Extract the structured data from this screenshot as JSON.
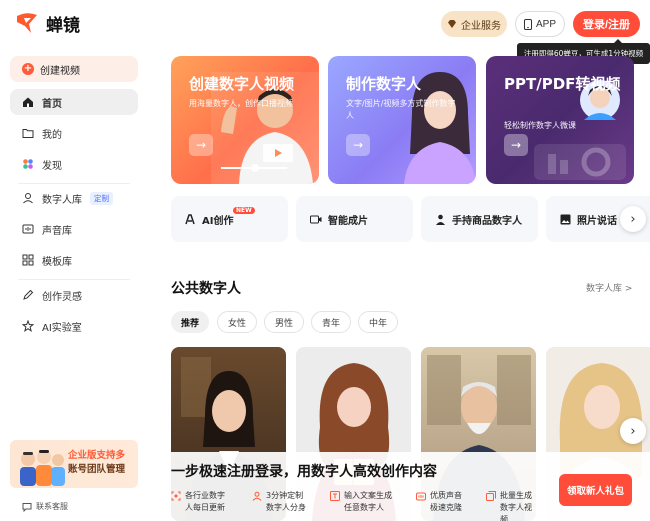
{
  "app": {
    "name": "蝉镜"
  },
  "header": {
    "enterprise_label": "企业服务",
    "app_label": "APP",
    "login_label": "登录/注册",
    "tooltip": "注册即得60蝉豆，可生成1分钟视频"
  },
  "sidebar": {
    "create_label": "创建视频",
    "items": [
      {
        "label": "首页",
        "icon": "home-icon",
        "active": true
      },
      {
        "label": "我的",
        "icon": "folder-icon"
      },
      {
        "label": "发现",
        "icon": "discover-icon"
      },
      {
        "label": "数字人库",
        "icon": "person-icon",
        "badge": "定制"
      },
      {
        "label": "声音库",
        "icon": "sound-icon"
      },
      {
        "label": "模板库",
        "icon": "template-icon"
      },
      {
        "label": "创作灵感",
        "icon": "pen-icon"
      },
      {
        "label": "AI实验室",
        "icon": "lab-icon"
      }
    ],
    "promo": {
      "line1": "企业版支持多",
      "line2": "账号团队管理"
    },
    "service_label": "联系客服"
  },
  "banners": [
    {
      "title": "创建数字人视频",
      "subtitle": "用海量数字人，创作口播视频"
    },
    {
      "title": "制作数字人",
      "subtitle": "文字/图片/视频多方式制作数字人"
    },
    {
      "title": "PPT/PDF转视频",
      "subtitle": "轻松制作数字人微课"
    }
  ],
  "features": [
    {
      "label": "AI创作",
      "new": "NEW"
    },
    {
      "label": "智能成片"
    },
    {
      "label": "手持商品数字人"
    },
    {
      "label": "照片说话"
    }
  ],
  "public_section": {
    "title": "公共数字人",
    "link": "数字人库 >",
    "filters": [
      "推荐",
      "女性",
      "男性",
      "青年",
      "中年"
    ]
  },
  "register_panel": {
    "title": "一步极速注册登录，用数字人高效创作内容",
    "features": [
      {
        "line1": "各行业数字",
        "line2": "人每日更新"
      },
      {
        "line1": "3分钟定制",
        "line2": "数字人分身"
      },
      {
        "line1": "输入文案生成",
        "line2": "任意数字人"
      },
      {
        "line1": "优质声音",
        "line2": "极速克隆"
      },
      {
        "line1": "批量生成",
        "line2": "数字人视",
        "line3": "频"
      }
    ],
    "cta": "领取新人礼包"
  },
  "colors": {
    "accent": "#ff4d3a",
    "enterprise_bg": "#f8e3c6"
  }
}
